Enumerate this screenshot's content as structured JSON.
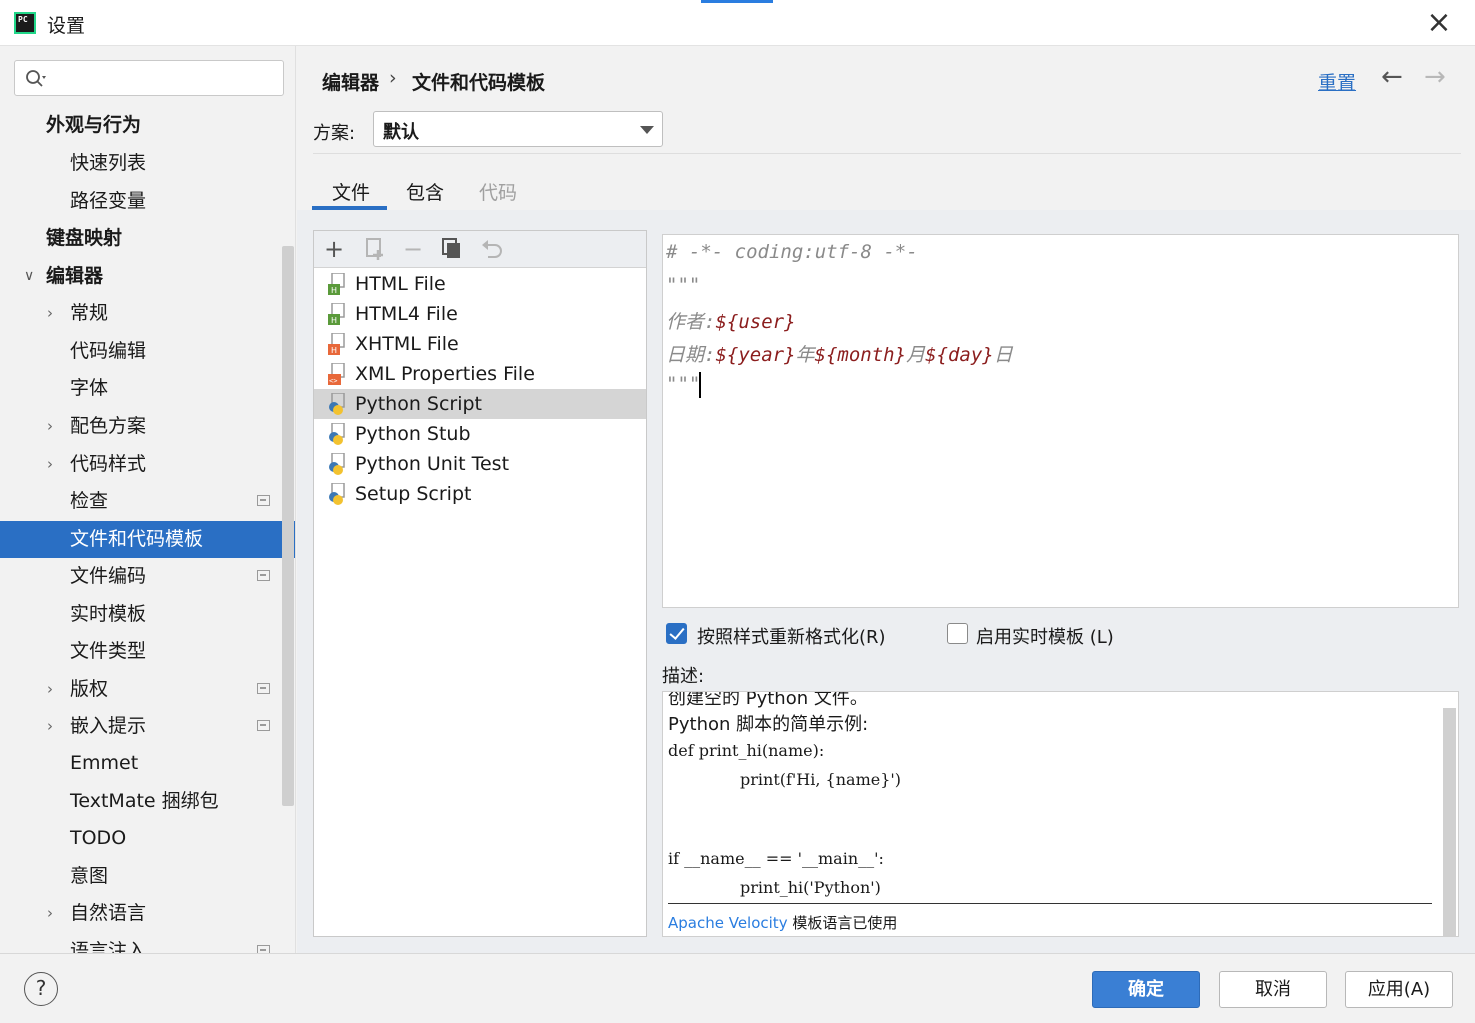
{
  "window": {
    "title": "设置",
    "app_icon_text": "PC"
  },
  "search": {
    "placeholder": ""
  },
  "sidebar": {
    "items": [
      {
        "label": "外观与行为"
      },
      {
        "label": "快速列表"
      },
      {
        "label": "路径变量"
      },
      {
        "label": "键盘映射"
      },
      {
        "label": "编辑器"
      },
      {
        "label": "常规"
      },
      {
        "label": "代码编辑"
      },
      {
        "label": "字体"
      },
      {
        "label": "配色方案"
      },
      {
        "label": "代码样式"
      },
      {
        "label": "检查"
      },
      {
        "label": "文件和代码模板"
      },
      {
        "label": "文件编码"
      },
      {
        "label": "实时模板"
      },
      {
        "label": "文件类型"
      },
      {
        "label": "版权"
      },
      {
        "label": "嵌入提示"
      },
      {
        "label": "Emmet"
      },
      {
        "label": "TextMate 捆绑包"
      },
      {
        "label": "TODO"
      },
      {
        "label": "意图"
      },
      {
        "label": "自然语言"
      },
      {
        "label": "语言注入"
      }
    ]
  },
  "header": {
    "breadcrumb": [
      "编辑器",
      "文件和代码模板"
    ],
    "separator": "›",
    "reset_label": "重置"
  },
  "scheme": {
    "label": "方案:",
    "value": "默认"
  },
  "tabs": [
    {
      "label": "文件"
    },
    {
      "label": "包含"
    },
    {
      "label": "代码"
    }
  ],
  "templates": [
    {
      "name": "HTML File"
    },
    {
      "name": "HTML4 File"
    },
    {
      "name": "XHTML File"
    },
    {
      "name": "XML Properties File"
    },
    {
      "name": "Python Script"
    },
    {
      "name": "Python Stub"
    },
    {
      "name": "Python Unit Test"
    },
    {
      "name": "Setup Script"
    }
  ],
  "editor": {
    "line1": "# -*- coding:utf-8 -*-",
    "line2": "\"\"\"",
    "author_label": "作者:",
    "author_var": "${user}",
    "date_label": "日期:",
    "year_var": "${year}",
    "year_unit": "年",
    "month_var": "${month}",
    "month_unit": "月",
    "day_var": "${day}",
    "day_unit": "日",
    "line5": "\"\"\""
  },
  "options": {
    "reformat_label": "按照样式重新格式化(R)",
    "reformat_checked": true,
    "live_template_label": "启用实时模板 (L)",
    "live_template_checked": false
  },
  "description": {
    "label": "描述:",
    "line_partial": "创建空的 Python 文件。",
    "intro": "Python 脚本的简单示例:",
    "code1": "def print_hi(name):",
    "code2": "print(f'Hi, {name}')",
    "code3": "if __name__ == '__main__':",
    "code4": "print_hi('Python')",
    "footer_link": "Apache Velocity",
    "footer_text": "模板语言已使用"
  },
  "buttons": {
    "help": "?",
    "ok": "确定",
    "cancel": "取消",
    "apply": "应用(A)"
  },
  "colors": {
    "accent": "#2a6fc4",
    "selection": "#2a6fc4",
    "code_var": "#8b1d1d"
  }
}
